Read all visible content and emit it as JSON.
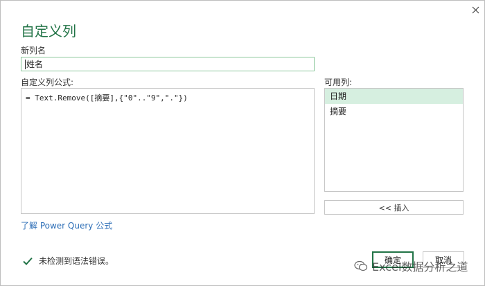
{
  "dialog": {
    "title": "自定义列",
    "close_icon": "close-icon"
  },
  "new_column": {
    "label": "新列名",
    "value": "姓名"
  },
  "formula": {
    "label": "自定义列公式:",
    "value": "= Text.Remove([摘要],{\"0\"..\"9\",\".\"})"
  },
  "available_columns": {
    "label": "可用列:",
    "items": [
      {
        "label": "日期",
        "selected": true
      },
      {
        "label": "摘要",
        "selected": false
      }
    ],
    "insert_label": "<< 插入"
  },
  "learn_link": "了解 Power Query 公式",
  "status": {
    "icon": "check-icon",
    "text": "未检测到语法错误。"
  },
  "buttons": {
    "ok": "确定",
    "cancel": "取消"
  },
  "watermark": {
    "icon": "wechat-icon",
    "text": "Excel数据分析之道"
  },
  "colors": {
    "accent": "#217346",
    "selection": "#d6efe0",
    "link": "#2e6fb7"
  }
}
